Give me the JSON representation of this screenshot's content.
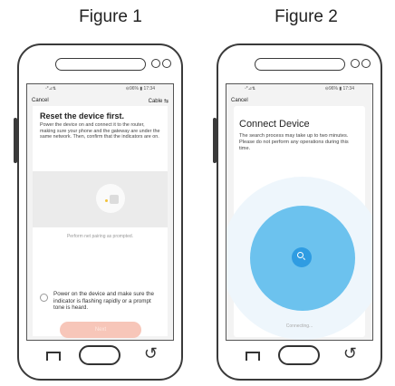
{
  "figures": [
    {
      "title": "Figure 1",
      "status_left": "▫︎*⊿⇅",
      "status_right": "⊖96% ▮ 17:34",
      "nav_left": "Cancel",
      "nav_right": "Cable ⇆",
      "heading": "Reset the device first.",
      "description": "Power the device on and connect it to the router, making sure your phone and the gateway are under the same network. Then, confirm that the indicators are on.",
      "link": "Perform net pairing as prompted.",
      "checkbox_label": "Power on the device and make sure the indicator is flashing rapidly or a prompt tone is heard.",
      "button_label": "Next"
    },
    {
      "title": "Figure 2",
      "status_left": "▫︎*⊿⇅",
      "status_right": "⊖96% ▮ 17:34",
      "nav_left": "Cancel",
      "heading": "Connect Device",
      "description": "The search process may take up to two minutes. Please do not perform any operations during this time.",
      "status_text": "Connecting..."
    }
  ],
  "icons": {
    "search": "search-icon",
    "recent": "recent-apps-icon",
    "home": "home-icon",
    "back": "back-icon"
  },
  "colors": {
    "accent_button": "#f7c6b9",
    "scan_outer": "#eef6fc",
    "scan_mid": "#6cc2ee",
    "scan_core": "#2f9ce2"
  }
}
